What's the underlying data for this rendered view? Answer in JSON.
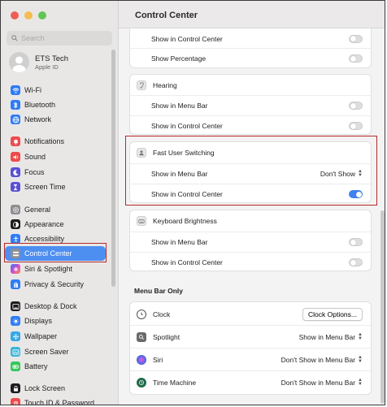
{
  "sidebar": {
    "search_placeholder": "Search",
    "account": {
      "name": "ETS Tech",
      "subtitle": "Apple ID"
    },
    "items": [
      {
        "label": "Wi-Fi",
        "icon": "wifi-icon",
        "color": "#2f7cf6"
      },
      {
        "label": "Bluetooth",
        "icon": "bluetooth-icon",
        "color": "#2f7cf6"
      },
      {
        "label": "Network",
        "icon": "globe-icon",
        "color": "#2f7cf6"
      },
      {
        "label": "Notifications",
        "icon": "bell-icon",
        "color": "#ef4b4b"
      },
      {
        "label": "Sound",
        "icon": "speaker-icon",
        "color": "#ef4b4b"
      },
      {
        "label": "Focus",
        "icon": "moon-icon",
        "color": "#5b4fd6"
      },
      {
        "label": "Screen Time",
        "icon": "hourglass-icon",
        "color": "#5b4fd6"
      },
      {
        "label": "General",
        "icon": "gear-icon",
        "color": "#8e8e93"
      },
      {
        "label": "Appearance",
        "icon": "appearance-icon",
        "color": "#1d1d1f"
      },
      {
        "label": "Accessibility",
        "icon": "accessibility-icon",
        "color": "#2f7cf6"
      },
      {
        "label": "Control Center",
        "icon": "control-center-icon",
        "color": "#8e8e93"
      },
      {
        "label": "Siri & Spotlight",
        "icon": "siri-icon",
        "color": "#b04bd8"
      },
      {
        "label": "Privacy & Security",
        "icon": "hand-icon",
        "color": "#2f7cf6"
      },
      {
        "label": "Desktop & Dock",
        "icon": "dock-icon",
        "color": "#1d1d1f"
      },
      {
        "label": "Displays",
        "icon": "display-icon",
        "color": "#2f7cf6"
      },
      {
        "label": "Wallpaper",
        "icon": "wallpaper-icon",
        "color": "#36a8e8"
      },
      {
        "label": "Screen Saver",
        "icon": "screensaver-icon",
        "color": "#36b5d8"
      },
      {
        "label": "Battery",
        "icon": "battery-icon",
        "color": "#34c759"
      },
      {
        "label": "Lock Screen",
        "icon": "lock-icon",
        "color": "#1d1d1f"
      },
      {
        "label": "Touch ID & Password",
        "icon": "fingerprint-icon",
        "color": "#ef4b4b"
      }
    ]
  },
  "main": {
    "title": "Control Center",
    "top_card": {
      "rows": [
        {
          "label": "Show in Control Center",
          "toggle": false
        },
        {
          "label": "Show Percentage",
          "toggle": false
        }
      ]
    },
    "hearing": {
      "title": "Hearing",
      "rows": [
        {
          "label": "Show in Menu Bar",
          "toggle": false
        },
        {
          "label": "Show in Control Center",
          "toggle": false
        }
      ]
    },
    "fast_user_switching": {
      "title": "Fast User Switching",
      "menu_bar_label": "Show in Menu Bar",
      "menu_bar_value": "Don't Show",
      "cc_label": "Show in Control Center",
      "cc_toggle": true
    },
    "keyboard_brightness": {
      "title": "Keyboard Brightness",
      "rows": [
        {
          "label": "Show in Menu Bar",
          "toggle": false
        },
        {
          "label": "Show in Control Center",
          "toggle": false
        }
      ]
    },
    "menu_bar_only": {
      "title": "Menu Bar Only",
      "clock": {
        "label": "Clock",
        "button": "Clock Options..."
      },
      "spotlight": {
        "label": "Spotlight",
        "value": "Show in Menu Bar"
      },
      "siri": {
        "label": "Siri",
        "value": "Don't Show in Menu Bar"
      },
      "time_machine": {
        "label": "Time Machine",
        "value": "Don't Show in Menu Bar"
      }
    }
  },
  "colors": {
    "accent": "#3f82ef",
    "selection": "#4d8ff1",
    "highlight": "#b52828"
  }
}
